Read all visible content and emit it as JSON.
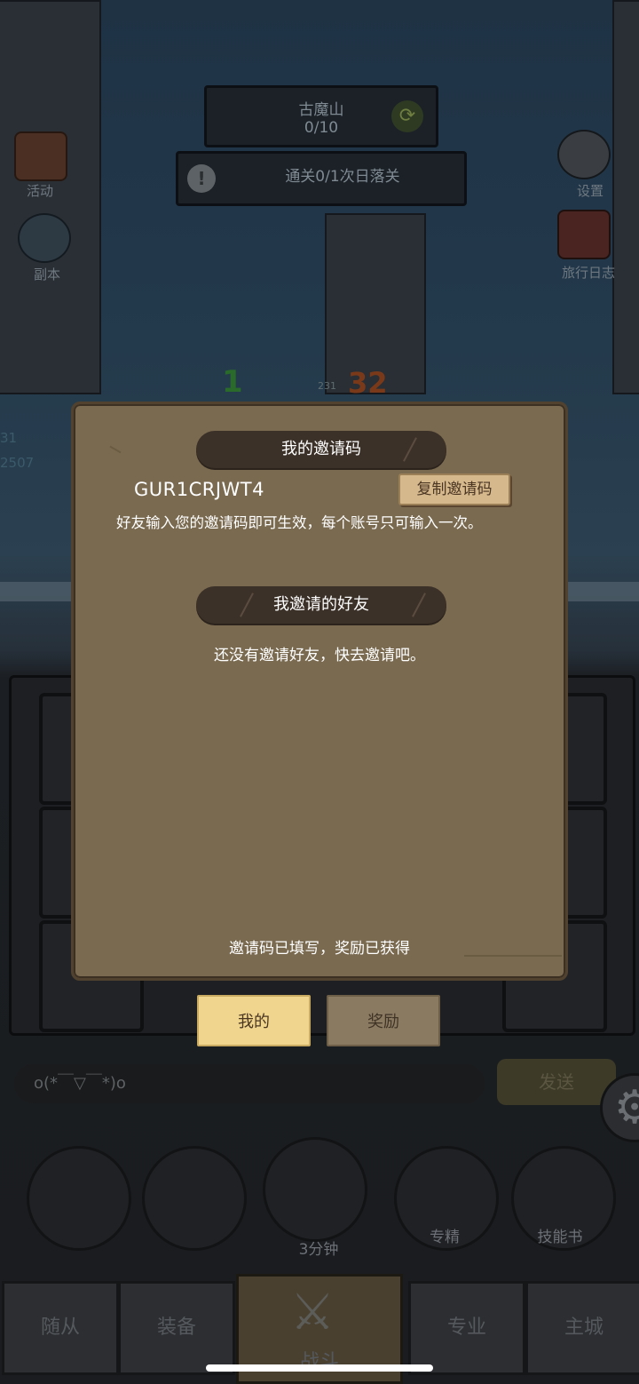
{
  "hud": {
    "zone_name": "古魔山",
    "zone_progress": "0/10",
    "clear_status": "通关0/1次日落关",
    "left_menu": [
      "活动",
      "副本"
    ],
    "right_menu": [
      "设置",
      "旅行日志"
    ],
    "battle_numbers": [
      "1",
      "231",
      "32",
      "31",
      "2507"
    ]
  },
  "dialog": {
    "section1_title": "我的邀请码",
    "invite_code": "GUR1CRJWT4",
    "copy_button": "复制邀请码",
    "description": "好友输入您的邀请码即可生效，每个账号只可输入一次。",
    "section2_title": "我邀请的好友",
    "empty_message": "还没有邀请好友，快去邀请吧。",
    "status_message": "邀请码已填写，奖励已获得"
  },
  "tabs": {
    "mine": "我的",
    "reward": "奖励"
  },
  "chat": {
    "input_text": "o(*￣▽￣*)o",
    "send_button": "发送"
  },
  "actions": {
    "chest_timer": "3分钟",
    "specialize": "专精",
    "skill_book": "技能书"
  },
  "nav": {
    "followers": "随从",
    "equipment": "装备",
    "battle": "战斗",
    "profession": "专业",
    "main_city": "主城"
  },
  "colors": {
    "dialog_bg": "#7a6a50",
    "pill_bg": "#3c3128",
    "copy_btn": "#d5b88c",
    "tab_active": "#f0d58e",
    "tab_inactive": "#8a7a62"
  }
}
